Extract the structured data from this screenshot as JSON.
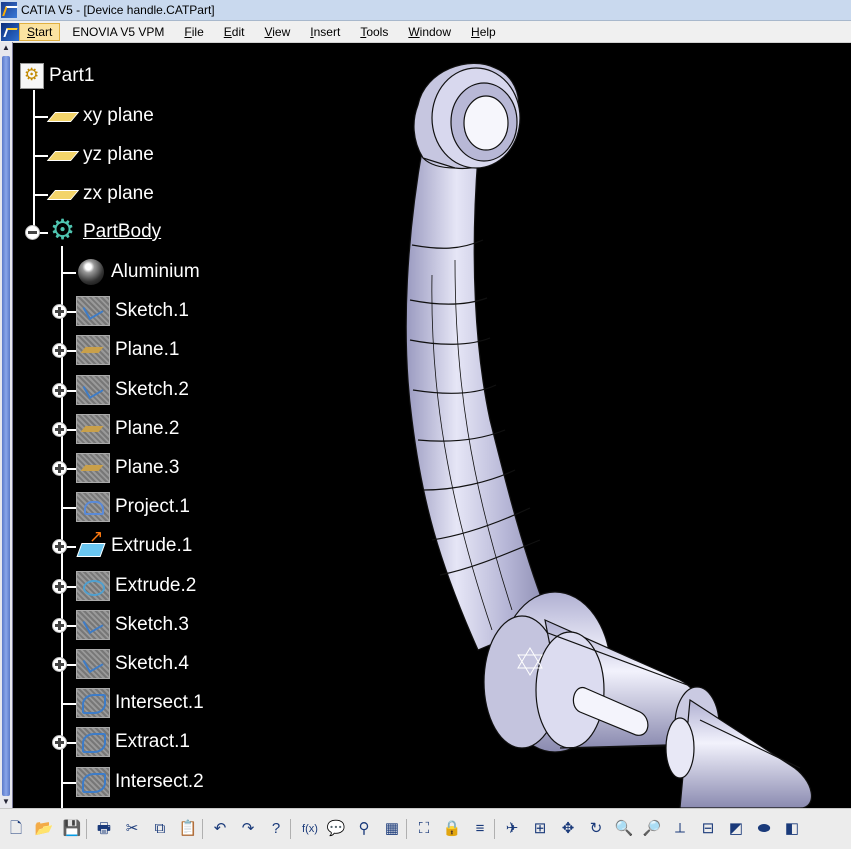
{
  "window": {
    "title": "CATIA V5 - [Device handle.CATPart]"
  },
  "menu": {
    "items": [
      {
        "label": "Start",
        "underline": "S",
        "rest": "tart",
        "active": true
      },
      {
        "label": "ENOVIA V5 VPM",
        "underline": "",
        "rest": "ENOVIA V5 VPM",
        "active": false
      },
      {
        "label": "File",
        "underline": "F",
        "rest": "ile",
        "active": false
      },
      {
        "label": "Edit",
        "underline": "E",
        "rest": "dit",
        "active": false
      },
      {
        "label": "View",
        "underline": "V",
        "rest": "iew",
        "active": false
      },
      {
        "label": "Insert",
        "underline": "I",
        "rest": "nsert",
        "active": false
      },
      {
        "label": "Tools",
        "underline": "T",
        "rest": "ools",
        "active": false
      },
      {
        "label": "Window",
        "underline": "W",
        "rest": "indow",
        "active": false
      },
      {
        "label": "Help",
        "underline": "H",
        "rest": "elp",
        "active": false
      }
    ]
  },
  "tree": {
    "root": {
      "label": "Part1",
      "icon": "part-icon"
    },
    "planes": [
      {
        "label": "xy plane",
        "icon": "plane-icon"
      },
      {
        "label": "yz plane",
        "icon": "plane-icon"
      },
      {
        "label": "zx plane",
        "icon": "plane-icon"
      }
    ],
    "body": {
      "label": "PartBody",
      "icon": "partbody-icon"
    },
    "children": [
      {
        "label": "Aluminium",
        "icon": "material-icon",
        "kind": "mat",
        "expandable": false
      },
      {
        "label": "Sketch.1",
        "icon": "sketch-icon",
        "kind": "sk",
        "expandable": true
      },
      {
        "label": "Plane.1",
        "icon": "plane-feature-icon",
        "kind": "pl",
        "expandable": true
      },
      {
        "label": "Sketch.2",
        "icon": "sketch-icon",
        "kind": "sk",
        "expandable": true
      },
      {
        "label": "Plane.2",
        "icon": "plane-feature-icon",
        "kind": "pl",
        "expandable": true
      },
      {
        "label": "Plane.3",
        "icon": "plane-feature-icon",
        "kind": "pl",
        "expandable": true
      },
      {
        "label": "Project.1",
        "icon": "project-icon",
        "kind": "pr",
        "expandable": false
      },
      {
        "label": "Extrude.1",
        "icon": "extrude-icon",
        "kind": "ext1",
        "expandable": true
      },
      {
        "label": "Extrude.2",
        "icon": "extrude-icon",
        "kind": "ex2",
        "expandable": true
      },
      {
        "label": "Sketch.3",
        "icon": "sketch-icon",
        "kind": "sk",
        "expandable": true
      },
      {
        "label": "Sketch.4",
        "icon": "sketch-icon",
        "kind": "sk",
        "expandable": true
      },
      {
        "label": "Intersect.1",
        "icon": "intersect-icon",
        "kind": "int",
        "expandable": false
      },
      {
        "label": "Extract.1",
        "icon": "extract-icon",
        "kind": "int",
        "expandable": true
      },
      {
        "label": "Intersect.2",
        "icon": "intersect-icon",
        "kind": "int",
        "expandable": false
      }
    ]
  },
  "toolbar": {
    "buttons": [
      {
        "name": "new-icon",
        "glyph": "🗋"
      },
      {
        "name": "open-icon",
        "glyph": "📂"
      },
      {
        "name": "save-icon",
        "glyph": "💾"
      },
      {
        "name": "print-icon",
        "glyph": "🖶"
      },
      {
        "name": "cut-icon",
        "glyph": "✂"
      },
      {
        "name": "copy-icon",
        "glyph": "⧉"
      },
      {
        "name": "paste-icon",
        "glyph": "📋"
      },
      {
        "name": "undo-icon",
        "glyph": "↶"
      },
      {
        "name": "redo-icon",
        "glyph": "↷"
      },
      {
        "name": "whats-this-icon",
        "glyph": "?"
      },
      {
        "name": "formula-icon",
        "glyph": "f(x)"
      },
      {
        "name": "comment-icon",
        "glyph": "💬"
      },
      {
        "name": "knowledge-icon",
        "glyph": "⚲"
      },
      {
        "name": "table-icon",
        "glyph": "▦"
      },
      {
        "name": "tree-icon",
        "glyph": "⛶"
      },
      {
        "name": "lock-icon",
        "glyph": "🔒"
      },
      {
        "name": "parameter-icon",
        "glyph": "≡"
      },
      {
        "name": "compass-icon",
        "glyph": "✈"
      },
      {
        "name": "fit-all-icon",
        "glyph": "⊞"
      },
      {
        "name": "pan-icon",
        "glyph": "✥"
      },
      {
        "name": "rotate-icon",
        "glyph": "↻"
      },
      {
        "name": "zoom-in-icon",
        "glyph": "🔍"
      },
      {
        "name": "zoom-out-icon",
        "glyph": "🔎"
      },
      {
        "name": "normal-view-icon",
        "glyph": "⟂"
      },
      {
        "name": "multi-view-icon",
        "glyph": "⊟"
      },
      {
        "name": "iso-view-icon",
        "glyph": "◩"
      },
      {
        "name": "shading-icon",
        "glyph": "⬬"
      },
      {
        "name": "hide-show-icon",
        "glyph": "◧"
      }
    ]
  }
}
